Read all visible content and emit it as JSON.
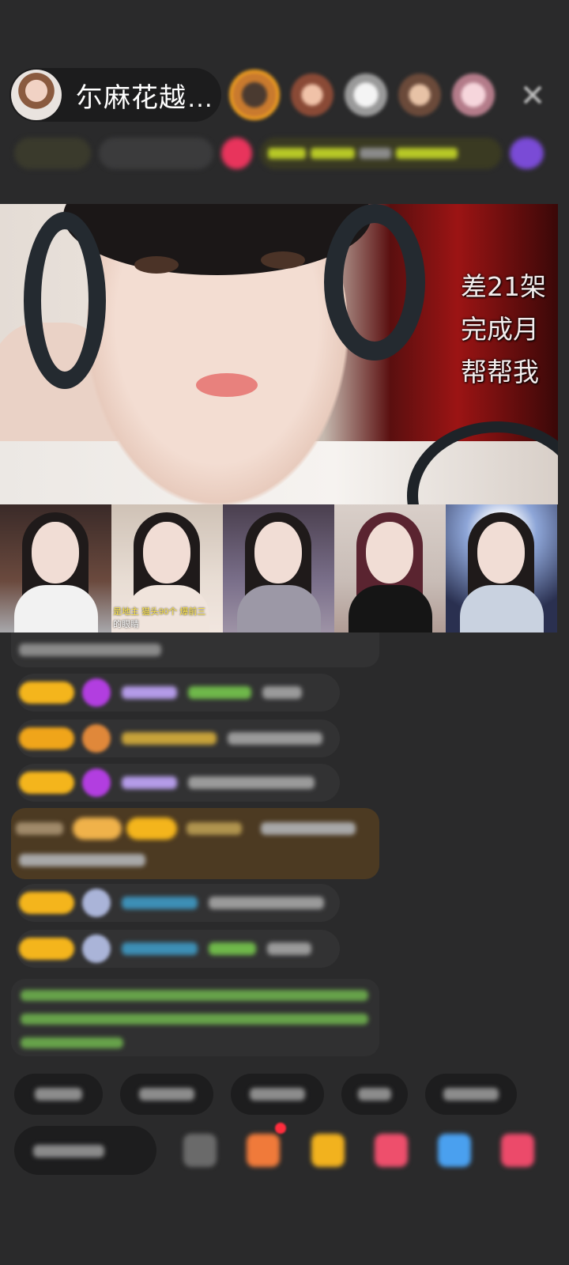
{
  "host": {
    "name": "尓麻花越…"
  },
  "viewers": {
    "avatar_colors": [
      "#c97a2e",
      "#b87864",
      "#d6d6d6",
      "#b78866",
      "#d8a4b2"
    ]
  },
  "video": {
    "overlay_lines": [
      "差21架",
      "完成月",
      "帮帮我"
    ]
  },
  "thumbnails": {
    "captions": [
      "是地主  猫头90个  爆前三",
      "的眼睛"
    ]
  },
  "colors": {
    "background": "#2a2a2b",
    "accent_orange": "#f3a21f",
    "level_badge": "#f4b51c",
    "chat_green": "#67a24a",
    "name_blue": "#3d8fb5"
  },
  "icons": {
    "close": "close-icon",
    "diamond": "diamond-badge-icon",
    "fan": "fan-badge-icon"
  }
}
